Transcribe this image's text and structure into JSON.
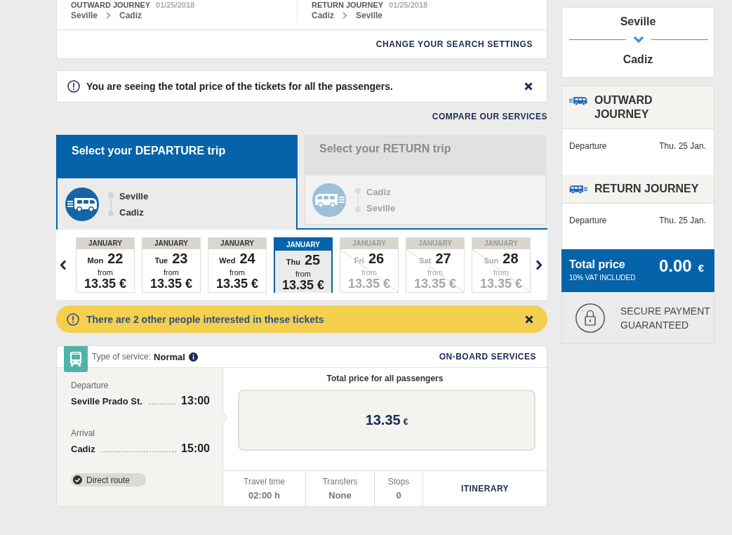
{
  "search_summary": {
    "journeys": [
      {
        "label": "OUTWARD JOURNEY",
        "date": "01/25/2018",
        "origin": "Seville",
        "destination": "Cadiz"
      },
      {
        "label": "RETURN JOURNEY",
        "date": "01/25/2018",
        "origin": "Cadiz",
        "destination": "Seville"
      }
    ],
    "change_link": "CHANGE YOUR SEARCH SETTINGS"
  },
  "notice": {
    "text": "You are seeing the total price of the tickets for all the passengers."
  },
  "compare_link": "COMPARE OUR SERVICES",
  "trip_tabs": [
    {
      "title": "Select your DEPARTURE trip",
      "kind": "outward",
      "selected": true,
      "stops": [
        "Seville",
        "Cadiz"
      ]
    },
    {
      "title": "Select your RETURN trip",
      "kind": "return",
      "selected": false,
      "stops": [
        "Cadiz",
        "Seville"
      ]
    }
  ],
  "dates": [
    {
      "month": "JANUARY",
      "weekday": "Mon",
      "day": "22",
      "from": "from",
      "price": "13.35 €",
      "selected": false,
      "disabled": false
    },
    {
      "month": "JANUARY",
      "weekday": "Tue",
      "day": "23",
      "from": "from",
      "price": "13.35 €",
      "selected": false,
      "disabled": false
    },
    {
      "month": "JANUARY",
      "weekday": "Wed",
      "day": "24",
      "from": "from",
      "price": "13.35 €",
      "selected": false,
      "disabled": false
    },
    {
      "month": "JANUARY",
      "weekday": "Thu",
      "day": "25",
      "from": "from",
      "price": "13.35 €",
      "selected": true,
      "disabled": false
    },
    {
      "month": "JANUARY",
      "weekday": "Fri",
      "day": "26",
      "from": "from",
      "price": "13.35 €",
      "selected": false,
      "disabled": true
    },
    {
      "month": "JANUARY",
      "weekday": "Sat",
      "day": "27",
      "from": "from",
      "price": "13.35 €",
      "selected": false,
      "disabled": true
    },
    {
      "month": "JANUARY",
      "weekday": "Sun",
      "day": "28",
      "from": "from",
      "price": "13.35 €",
      "selected": false,
      "disabled": true
    }
  ],
  "alert": {
    "text": "There are 2 other people interested in these tickets"
  },
  "result": {
    "service_label": "Type of service:",
    "service": "Normal",
    "onboard_link": "ON-BOARD SERVICES",
    "stops": [
      {
        "label": "Departure",
        "station": "Seville Prado St.",
        "time": "13:00"
      },
      {
        "label": "Arrival",
        "station": "Cadiz",
        "time": "15:00"
      }
    ],
    "route_badge": "Direct route",
    "price_label": "Total price for all passengers",
    "price": "13.35",
    "currency": "€",
    "stats": [
      {
        "label": "Travel time",
        "value": "02:00 h"
      },
      {
        "label": "Transfers",
        "value": "None"
      },
      {
        "label": "Stops",
        "value": "0"
      }
    ],
    "itinerary_button": "ITINERARY"
  },
  "sidebar": {
    "route": {
      "origin": "Seville",
      "destination": "Cadiz"
    },
    "journeys": [
      {
        "title": "OUTWARD JOURNEY",
        "kind": "outward",
        "rows": [
          {
            "label": "Departure",
            "value": "Thu. 25 Jan."
          }
        ]
      },
      {
        "title": "RETURN JOURNEY",
        "kind": "return",
        "rows": [
          {
            "label": "Departure",
            "value": "Thu. 25 Jan."
          }
        ]
      }
    ],
    "total": {
      "label": "Total price",
      "vat": "10% VAT INCLUDED",
      "amount": "0.00",
      "currency": "€"
    },
    "secure": "SECURE PAYMENT GUARANTEED"
  }
}
